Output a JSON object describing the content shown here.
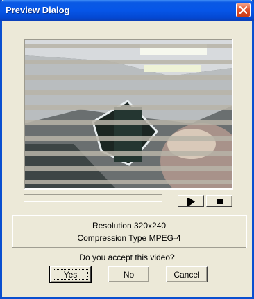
{
  "window": {
    "title": "Preview Dialog"
  },
  "media": {
    "play_icon": "play-icon",
    "stop_icon": "stop-icon",
    "progress": 0
  },
  "info": {
    "resolution_label": "Resolution",
    "resolution_value": "320x240",
    "compression_label": "Compression Type",
    "compression_value": "MPEG-4"
  },
  "prompt": {
    "question": "Do you accept this video?"
  },
  "buttons": {
    "yes": "Yes",
    "no": "No",
    "cancel": "Cancel"
  },
  "colors": {
    "titlebar": "#0656e8",
    "dialog_bg": "#ece9d8",
    "close_button": "#e0532c"
  }
}
